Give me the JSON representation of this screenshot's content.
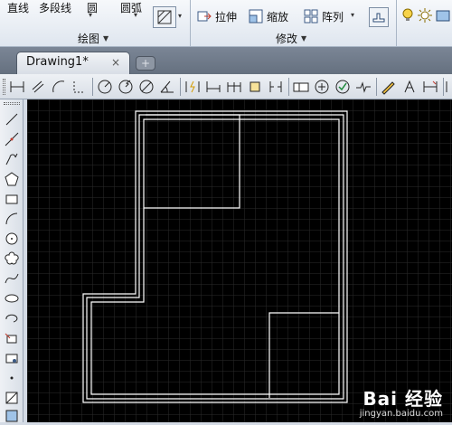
{
  "ribbon": {
    "draw_tools": [
      "直线",
      "多段线",
      "圆",
      "圆弧"
    ],
    "draw_panel_title": "绘图",
    "modify_tools": [
      {
        "label": "拉伸",
        "icon": "stretch-icon"
      },
      {
        "label": "缩放",
        "icon": "scale-icon"
      },
      {
        "label": "阵列",
        "icon": "array-icon"
      }
    ],
    "modify_panel_title": "修改"
  },
  "document_tab": {
    "title": "Drawing1*",
    "close_glyph": "×"
  },
  "watermark": {
    "brand": "Bai 经验",
    "url": "jingyan.baidu.com"
  },
  "colors": {
    "canvas_bg": "#000000",
    "grid": "#2e2e2e",
    "geometry": "#ffffff",
    "ribbon_bg": "#e8edf3"
  }
}
